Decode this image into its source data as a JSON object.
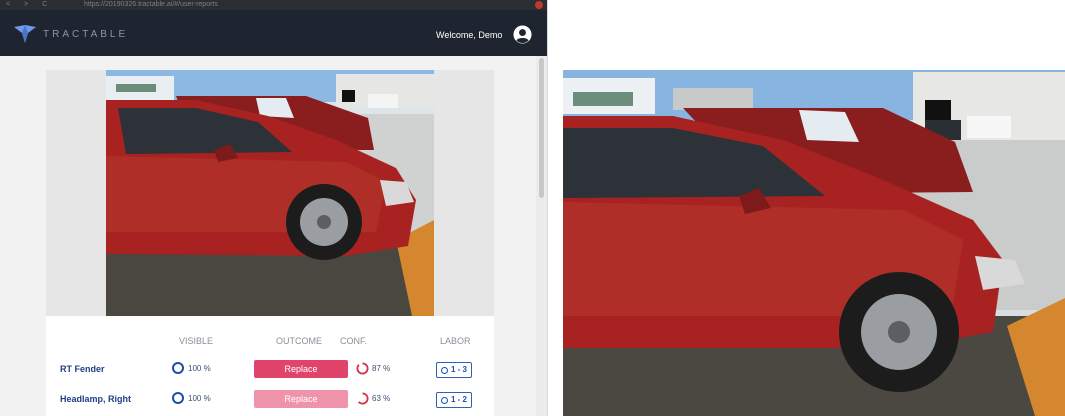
{
  "browser": {
    "url": "https://20190326.tractable.ai/#/user-reports",
    "controls": "< > C"
  },
  "app": {
    "brand": "TRACTABLE",
    "welcome": "Welcome, Demo"
  },
  "table": {
    "headers": {
      "visible": "VISIBLE",
      "outcome": "OUTCOME",
      "conf": "CONF.",
      "labor": "LABOR"
    },
    "rows": [
      {
        "part": "RT Fender",
        "visible": "100 %",
        "outcome": "Replace",
        "confidence": "87 %",
        "conf_value": 87,
        "labor": "1 - 3",
        "outcome_color": "#e0446a"
      },
      {
        "part": "Headlamp, Right",
        "visible": "100 %",
        "outcome": "Replace",
        "confidence": "63 %",
        "conf_value": 63,
        "labor": "1 - 2",
        "outcome_color": "#ee93aa"
      }
    ]
  },
  "colors": {
    "appbar": "#1e2530",
    "accent_blue": "#1b4fa5",
    "replace_strong": "#e0446a",
    "replace_light": "#ee93aa",
    "confidence_ring": "#d6344f",
    "car_red": "#a82222"
  },
  "icons": [
    "tractable-logo-icon",
    "user-account-icon",
    "visible-ring-icon",
    "confidence-arc-icon",
    "clock-icon"
  ]
}
